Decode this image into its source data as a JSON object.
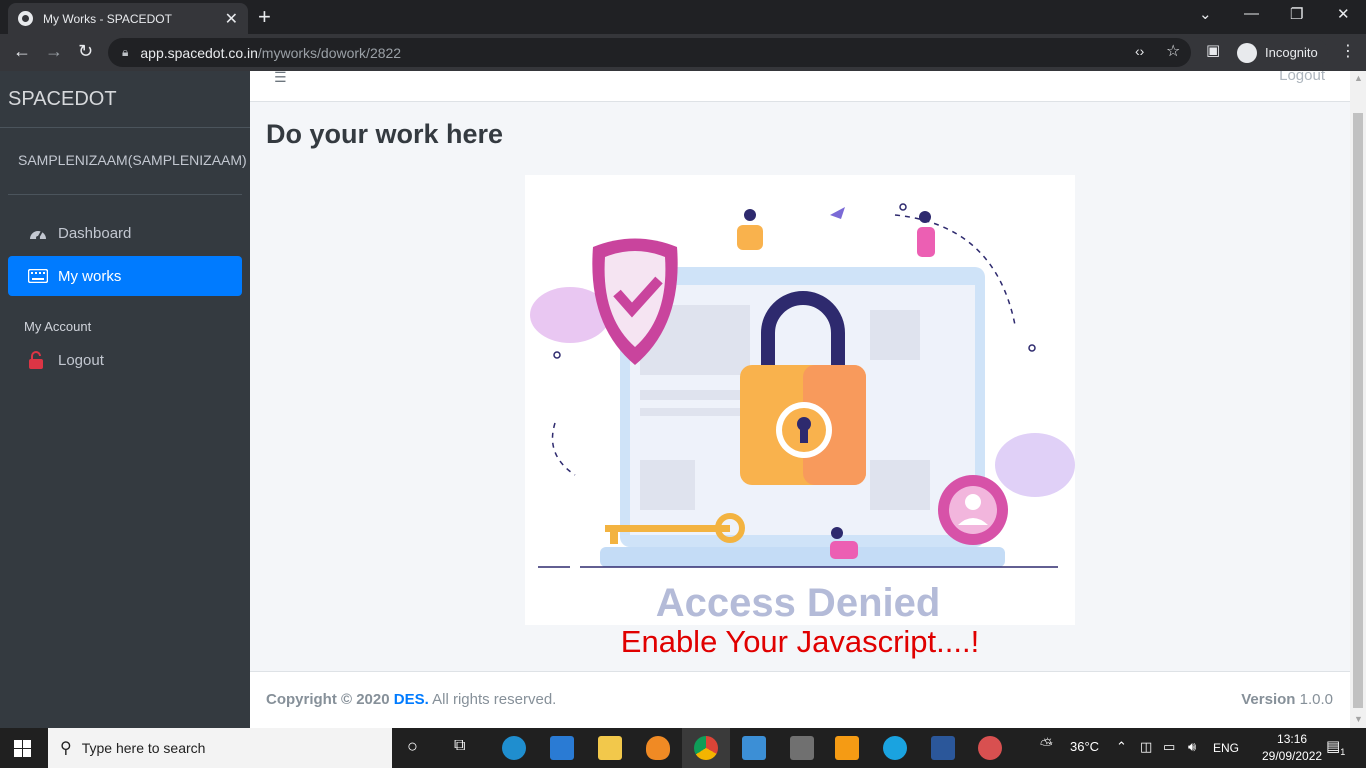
{
  "browser": {
    "tab_title": "My Works - SPACEDOT",
    "url_host": "app.spacedot.co.in",
    "url_path": "/myworks/dowork/2822",
    "incognito_label": "Incognito"
  },
  "sidebar": {
    "brand": "SPACEDOT",
    "user": "SAMPLENIZAAM(SAMPLENIZAAM)",
    "items": [
      {
        "label": "Dashboard",
        "icon": "gauge-icon"
      },
      {
        "label": "My works",
        "icon": "keyboard-icon",
        "active": true
      }
    ],
    "section_header": "My Account",
    "logout_label": "Logout"
  },
  "topnav": {
    "logout_label": "Logout"
  },
  "main": {
    "page_title": "Do your work here",
    "image_caption": "Access Denied",
    "error_message": "Enable Your Javascript....!"
  },
  "footer": {
    "copyright_prefix": "Copyright © 2020",
    "company": "DES.",
    "rights": "All rights reserved.",
    "version_label": "Version",
    "version_value": "1.0.0"
  },
  "taskbar": {
    "search_placeholder": "Type here to search",
    "weather": "36°C",
    "language": "ENG",
    "time": "13:16",
    "date": "29/09/2022",
    "notification_count": "1"
  },
  "colors": {
    "sidebar_bg": "#343a40",
    "active_item": "#007bff",
    "error_text": "#e00000"
  }
}
